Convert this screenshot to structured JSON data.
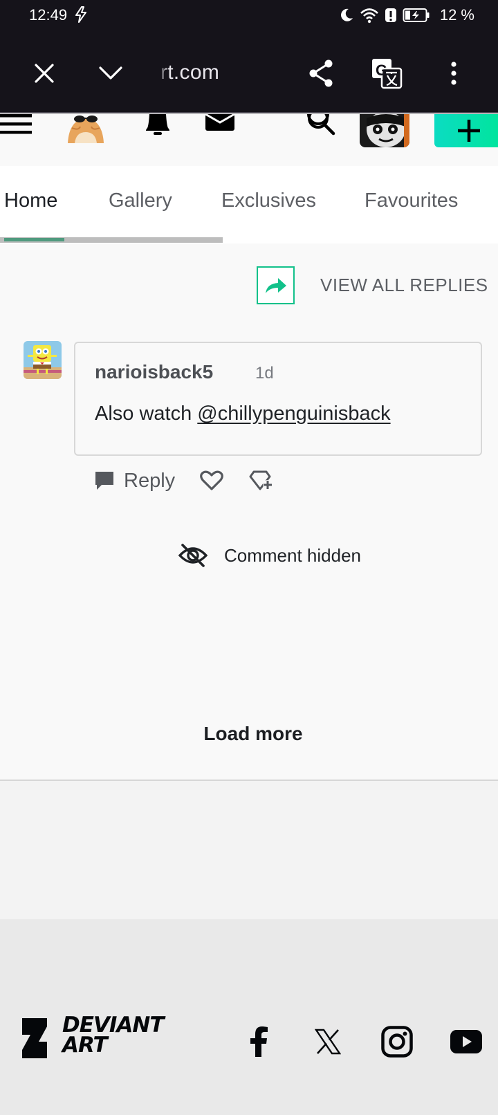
{
  "status": {
    "time": "12:49",
    "battery": "12 %"
  },
  "browser": {
    "url": "rt.com"
  },
  "tabs": [
    {
      "label": "Home"
    },
    {
      "label": "Gallery"
    },
    {
      "label": "Exclusives"
    },
    {
      "label": "Favourites"
    }
  ],
  "comments": {
    "view_all_label": "VIEW ALL REPLIES",
    "reply": {
      "username": "narioisback5",
      "time": "1d",
      "text_prefix": "Also watch ",
      "mention": "@chillypenguinisback",
      "reply_label": "Reply"
    },
    "hidden_label": "Comment hidden",
    "load_more": "Load more"
  },
  "footer": {
    "logo_line1": "DEVIANT",
    "logo_line2": "ART"
  },
  "colors": {
    "accent_green": "#00e59b",
    "dark_bar": "#15131a",
    "tab_indicator": "#4f9a7e"
  },
  "icons": [
    "close-icon",
    "chevron-down-icon",
    "share-icon",
    "translate-icon",
    "more-vert-icon",
    "menu-icon",
    "bell-icon",
    "mail-icon",
    "search-icon",
    "plus-icon",
    "reply-arrow-icon",
    "comment-icon",
    "heart-icon",
    "gem-add-icon",
    "eye-off-icon",
    "facebook-icon",
    "x-icon",
    "instagram-icon",
    "youtube-icon"
  ]
}
